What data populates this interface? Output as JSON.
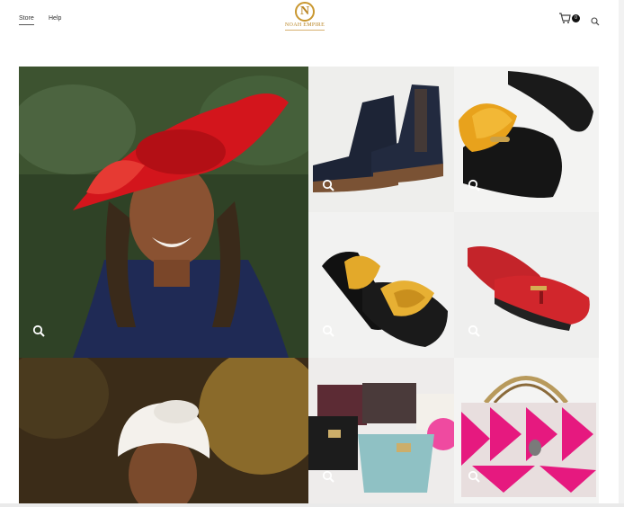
{
  "nav": {
    "store": "Store",
    "help": "Help"
  },
  "logo": {
    "monogram": "N",
    "name": "NOAH EMPIRE"
  },
  "cart": {
    "count": "0"
  },
  "icons": {
    "cart": "shopping-bag-icon",
    "search": "search-icon",
    "zoom": "magnifier-icon"
  },
  "colors": {
    "accent": "#c9972f",
    "text": "#333333"
  },
  "products": [
    {
      "subject": "woman-red-fascinator-hat"
    },
    {
      "subject": "navy-suede-chelsea-boots"
    },
    {
      "subject": "black-mules-orange-fur"
    },
    {
      "subject": "mustard-knot-slides"
    },
    {
      "subject": "red-tassel-loafers"
    },
    {
      "subject": "woman-white-headwrap"
    },
    {
      "subject": "assorted-handbags"
    },
    {
      "subject": "pink-woven-handbag"
    }
  ]
}
